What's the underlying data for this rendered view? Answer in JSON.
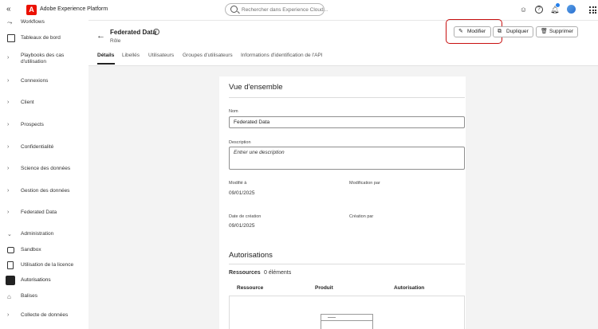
{
  "topbar": {
    "app_name": "Adobe Experience Platform",
    "logo_letter": "A",
    "search_placeholder": "Rechercher dans Experience Cloud..."
  },
  "sidebar": {
    "items": [
      {
        "label": "Workflows",
        "icon": "workflow-icon"
      },
      {
        "label": "Tableaux de bord",
        "icon": "dashboard-icon"
      },
      {
        "label": "Playbooks des cas d'utilisation",
        "icon": "chevron-right-icon"
      },
      {
        "label": "Connexions",
        "icon": "chevron-right-icon"
      },
      {
        "label": "Client",
        "icon": "chevron-right-icon"
      },
      {
        "label": "Prospects",
        "icon": "chevron-right-icon"
      },
      {
        "label": "Confidentialité",
        "icon": "chevron-right-icon"
      },
      {
        "label": "Science des données",
        "icon": "chevron-right-icon"
      },
      {
        "label": "Gestion des données",
        "icon": "chevron-right-icon"
      },
      {
        "label": "Federated Data",
        "icon": "chevron-right-icon"
      },
      {
        "label": "Administration",
        "icon": "chevron-down-icon"
      },
      {
        "label": "Sandbox",
        "icon": "sandbox-icon"
      },
      {
        "label": "Utilisation de la licence",
        "icon": "license-icon"
      },
      {
        "label": "Autorisations",
        "icon": "permissions-icon",
        "active": true
      },
      {
        "label": "Balises",
        "icon": "tag-icon"
      },
      {
        "label": "Collecte de données",
        "icon": "chevron-right-icon"
      }
    ]
  },
  "header": {
    "title": "Federated Data",
    "subtitle": "Rôle",
    "tabs": [
      "Détails",
      "Libellés",
      "Utilisateurs",
      "Groupes d'utilisateurs",
      "Informations d'identification de l'API"
    ],
    "buttons": {
      "edit": "Modifier",
      "duplicate": "Dupliquer",
      "delete": "Supprimer"
    }
  },
  "overview": {
    "title": "Vue d'ensemble",
    "name_label": "Nom",
    "name_value": "Federated Data",
    "description_label": "Description",
    "description_placeholder": "Entrer une description",
    "modified_label": "Modifié à",
    "modified_value": "09/01/2025",
    "modified_by_label": "Modification par",
    "created_label": "Date de création",
    "created_value": "09/01/2025",
    "created_by_label": "Création par"
  },
  "permissions": {
    "title": "Autorisations",
    "resources_label": "Ressources",
    "resources_count": "0 éléments",
    "columns": [
      "Ressource",
      "Produit",
      "Autorisation"
    ]
  }
}
